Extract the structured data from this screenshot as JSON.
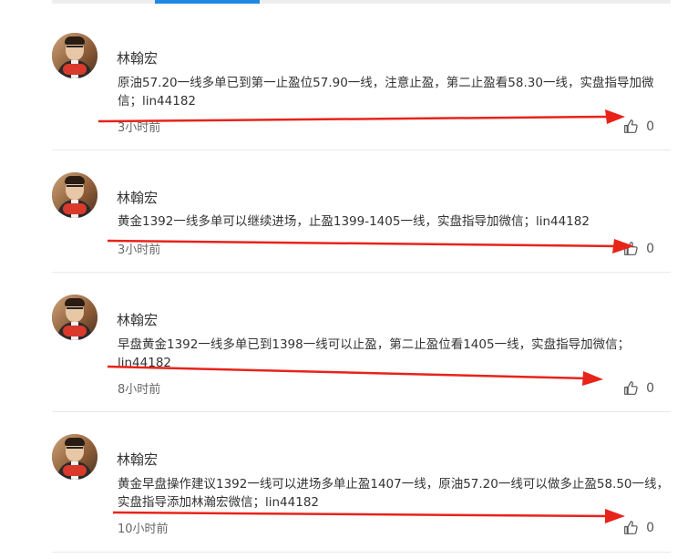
{
  "posts": [
    {
      "author": "林翰宏",
      "content": "原油57.20一线多单已到第一止盈位57.90一线，注意止盈，第二止盈看58.30一线，实盘指导加微信；lin44182",
      "time": "3小时前",
      "likes": "0"
    },
    {
      "author": "林翰宏",
      "content": "黄金1392一线多单可以继续进场，止盈1399-1405一线，实盘指导加微信；lin44182",
      "time": "3小时前",
      "likes": "0"
    },
    {
      "author": "林翰宏",
      "content": "早盘黄金1392一线多单已到1398一线可以止盈，第二止盈位看1405一线，实盘指导加微信；lin44182",
      "time": "8小时前",
      "likes": "0"
    },
    {
      "author": "林翰宏",
      "content": "黄金早盘操作建议1392一线可以进场多单止盈1407一线，原油57.20一线可以做多止盈58.50一线，实盘指导添加林瀚宏微信；lin44182",
      "time": "10小时前",
      "likes": "0"
    }
  ],
  "icons": {
    "like": "thumbs-up-icon",
    "annotation": "red-arrow"
  },
  "colors": {
    "annotation": "#e8231a",
    "tab_active": "#1e88e5"
  }
}
